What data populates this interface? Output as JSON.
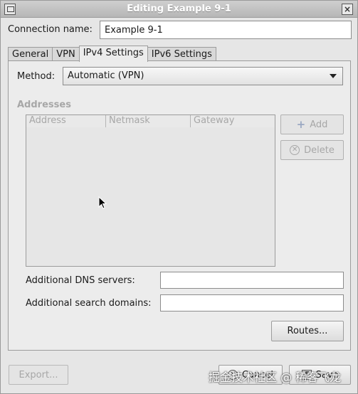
{
  "window": {
    "title": "Editing Example 9-1"
  },
  "connection": {
    "label": "Connection name:",
    "value": "Example 9-1"
  },
  "tabs": [
    {
      "label": "General"
    },
    {
      "label": "VPN"
    },
    {
      "label": "IPv4 Settings"
    },
    {
      "label": "IPv6 Settings"
    }
  ],
  "ipv4": {
    "method_label": "Method:",
    "method_value": "Automatic (VPN)",
    "addresses_heading": "Addresses",
    "columns": [
      "Address",
      "Netmask",
      "Gateway"
    ],
    "add_label": "Add",
    "delete_label": "Delete",
    "dns_label": "Additional DNS servers:",
    "search_label": "Additional search domains:",
    "routes_label": "Routes..."
  },
  "footer": {
    "export_label": "Export...",
    "cancel_label": "Cancel",
    "save_label": "Save"
  },
  "watermark": "掘金技术社区 @ 稀客飞龙"
}
